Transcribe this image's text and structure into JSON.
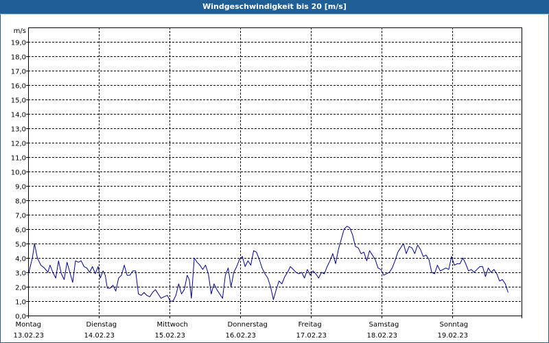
{
  "window": {
    "title": "Windgeschwindigkeit bis 20 [m/s]"
  },
  "chart_data": {
    "type": "line",
    "ylabel": "m/s",
    "ylim": [
      0,
      20
    ],
    "yticks": [
      "0,0",
      "1,0",
      "2,0",
      "3,0",
      "4,0",
      "5,0",
      "6,0",
      "7,0",
      "8,0",
      "9,0",
      "10,0",
      "11,0",
      "12,0",
      "13,0",
      "14,0",
      "15,0",
      "16,0",
      "17,0",
      "18,0",
      "19,0"
    ],
    "xticks": [
      {
        "day": "Montag",
        "date": "13.02.23"
      },
      {
        "day": "Dienstag",
        "date": "14.02.23"
      },
      {
        "day": "Mittwoch",
        "date": "15.02.23"
      },
      {
        "day": "Donnerstag",
        "date": "16.02.23"
      },
      {
        "day": "Freitag",
        "date": "17.02.23"
      },
      {
        "day": "Samstag",
        "date": "18.02.23"
      },
      {
        "day": "Sonntag",
        "date": "19.02.23"
      }
    ],
    "grid": true,
    "line_color": "#00008b",
    "x_unit": "days from Montag 13.02.23 00:00",
    "xlim": [
      0,
      7
    ],
    "series": [
      {
        "name": "",
        "points": [
          [
            0.0,
            2.8
          ],
          [
            0.06,
            4.0
          ],
          [
            0.09,
            5.0
          ],
          [
            0.13,
            4.0
          ],
          [
            0.18,
            3.5
          ],
          [
            0.23,
            3.3
          ],
          [
            0.28,
            3.0
          ],
          [
            0.31,
            3.5
          ],
          [
            0.35,
            3.0
          ],
          [
            0.39,
            2.6
          ],
          [
            0.43,
            3.8
          ],
          [
            0.47,
            2.9
          ],
          [
            0.51,
            2.5
          ],
          [
            0.55,
            3.7
          ],
          [
            0.59,
            3.0
          ],
          [
            0.63,
            2.3
          ],
          [
            0.67,
            3.8
          ],
          [
            0.71,
            3.7
          ],
          [
            0.75,
            3.8
          ],
          [
            0.79,
            3.4
          ],
          [
            0.83,
            3.3
          ],
          [
            0.87,
            3.0
          ],
          [
            0.91,
            3.4
          ],
          [
            0.95,
            2.9
          ],
          [
            0.99,
            3.4
          ],
          [
            1.02,
            2.6
          ],
          [
            1.06,
            3.1
          ],
          [
            1.09,
            2.8
          ],
          [
            1.12,
            1.9
          ],
          [
            1.16,
            1.9
          ],
          [
            1.2,
            2.1
          ],
          [
            1.24,
            1.7
          ],
          [
            1.28,
            2.6
          ],
          [
            1.32,
            2.8
          ],
          [
            1.36,
            3.5
          ],
          [
            1.4,
            2.8
          ],
          [
            1.44,
            2.8
          ],
          [
            1.48,
            3.1
          ],
          [
            1.52,
            3.1
          ],
          [
            1.56,
            1.5
          ],
          [
            1.6,
            1.4
          ],
          [
            1.64,
            1.6
          ],
          [
            1.68,
            1.4
          ],
          [
            1.72,
            1.3
          ],
          [
            1.76,
            1.6
          ],
          [
            1.8,
            1.8
          ],
          [
            1.84,
            1.5
          ],
          [
            1.88,
            1.2
          ],
          [
            1.92,
            1.3
          ],
          [
            1.97,
            1.4
          ],
          [
            2.01,
            1.0
          ],
          [
            2.05,
            1.0
          ],
          [
            2.09,
            1.4
          ],
          [
            2.13,
            2.2
          ],
          [
            2.17,
            1.5
          ],
          [
            2.21,
            1.8
          ],
          [
            2.25,
            2.8
          ],
          [
            2.28,
            2.5
          ],
          [
            2.31,
            1.2
          ],
          [
            2.35,
            4.0
          ],
          [
            2.39,
            3.7
          ],
          [
            2.43,
            3.5
          ],
          [
            2.47,
            3.2
          ],
          [
            2.51,
            3.5
          ],
          [
            2.55,
            2.9
          ],
          [
            2.59,
            1.5
          ],
          [
            2.63,
            2.2
          ],
          [
            2.67,
            1.8
          ],
          [
            2.71,
            1.5
          ],
          [
            2.75,
            1.2
          ],
          [
            2.79,
            2.8
          ],
          [
            2.83,
            3.3
          ],
          [
            2.87,
            2.0
          ],
          [
            2.91,
            3.0
          ],
          [
            2.95,
            3.4
          ],
          [
            2.99,
            3.9
          ],
          [
            3.03,
            4.1
          ],
          [
            3.07,
            3.4
          ],
          [
            3.11,
            3.8
          ],
          [
            3.15,
            3.5
          ],
          [
            3.19,
            4.5
          ],
          [
            3.23,
            4.4
          ],
          [
            3.27,
            3.9
          ],
          [
            3.31,
            3.3
          ],
          [
            3.35,
            2.9
          ],
          [
            3.39,
            2.6
          ],
          [
            3.43,
            2.0
          ],
          [
            3.47,
            1.1
          ],
          [
            3.51,
            1.8
          ],
          [
            3.55,
            2.4
          ],
          [
            3.59,
            2.2
          ],
          [
            3.63,
            2.7
          ],
          [
            3.67,
            3.0
          ],
          [
            3.71,
            3.4
          ],
          [
            3.75,
            3.2
          ],
          [
            3.79,
            3.0
          ],
          [
            3.83,
            2.9
          ],
          [
            3.87,
            3.0
          ],
          [
            3.91,
            2.6
          ],
          [
            3.95,
            3.2
          ],
          [
            3.99,
            2.8
          ],
          [
            4.03,
            3.1
          ],
          [
            4.07,
            2.9
          ],
          [
            4.11,
            2.6
          ],
          [
            4.15,
            3.0
          ],
          [
            4.19,
            2.9
          ],
          [
            4.23,
            3.4
          ],
          [
            4.27,
            3.8
          ],
          [
            4.31,
            4.3
          ],
          [
            4.35,
            3.6
          ],
          [
            4.39,
            4.6
          ],
          [
            4.43,
            5.3
          ],
          [
            4.47,
            6.0
          ],
          [
            4.51,
            6.2
          ],
          [
            4.55,
            6.1
          ],
          [
            4.59,
            5.6
          ],
          [
            4.63,
            4.8
          ],
          [
            4.67,
            4.7
          ],
          [
            4.71,
            4.3
          ],
          [
            4.75,
            4.4
          ],
          [
            4.79,
            3.8
          ],
          [
            4.83,
            4.5
          ],
          [
            4.87,
            4.2
          ],
          [
            4.91,
            3.9
          ],
          [
            4.95,
            3.3
          ],
          [
            4.99,
            3.2
          ],
          [
            5.03,
            2.8
          ],
          [
            5.07,
            2.9
          ],
          [
            5.11,
            3.0
          ],
          [
            5.15,
            3.3
          ],
          [
            5.19,
            3.8
          ],
          [
            5.23,
            4.4
          ],
          [
            5.27,
            4.7
          ],
          [
            5.31,
            5.0
          ],
          [
            5.35,
            4.3
          ],
          [
            5.39,
            4.8
          ],
          [
            5.43,
            4.7
          ],
          [
            5.47,
            4.3
          ],
          [
            5.51,
            4.9
          ],
          [
            5.55,
            4.6
          ],
          [
            5.59,
            4.1
          ],
          [
            5.63,
            4.2
          ],
          [
            5.67,
            3.9
          ],
          [
            5.71,
            3.0
          ],
          [
            5.75,
            2.9
          ],
          [
            5.79,
            3.5
          ],
          [
            5.83,
            3.1
          ],
          [
            5.87,
            3.2
          ],
          [
            5.91,
            3.3
          ],
          [
            5.95,
            3.2
          ],
          [
            5.99,
            4.1
          ],
          [
            6.03,
            3.5
          ],
          [
            6.07,
            3.6
          ],
          [
            6.11,
            3.6
          ],
          [
            6.15,
            4.0
          ],
          [
            6.19,
            3.6
          ],
          [
            6.23,
            3.1
          ],
          [
            6.27,
            3.2
          ],
          [
            6.31,
            3.0
          ],
          [
            6.35,
            3.2
          ],
          [
            6.39,
            3.4
          ],
          [
            6.43,
            3.4
          ],
          [
            6.47,
            2.7
          ],
          [
            6.51,
            3.3
          ],
          [
            6.55,
            3.0
          ],
          [
            6.59,
            3.2
          ],
          [
            6.63,
            2.9
          ],
          [
            6.67,
            2.4
          ],
          [
            6.71,
            2.5
          ],
          [
            6.75,
            2.2
          ],
          [
            6.79,
            1.6
          ]
        ]
      }
    ]
  }
}
